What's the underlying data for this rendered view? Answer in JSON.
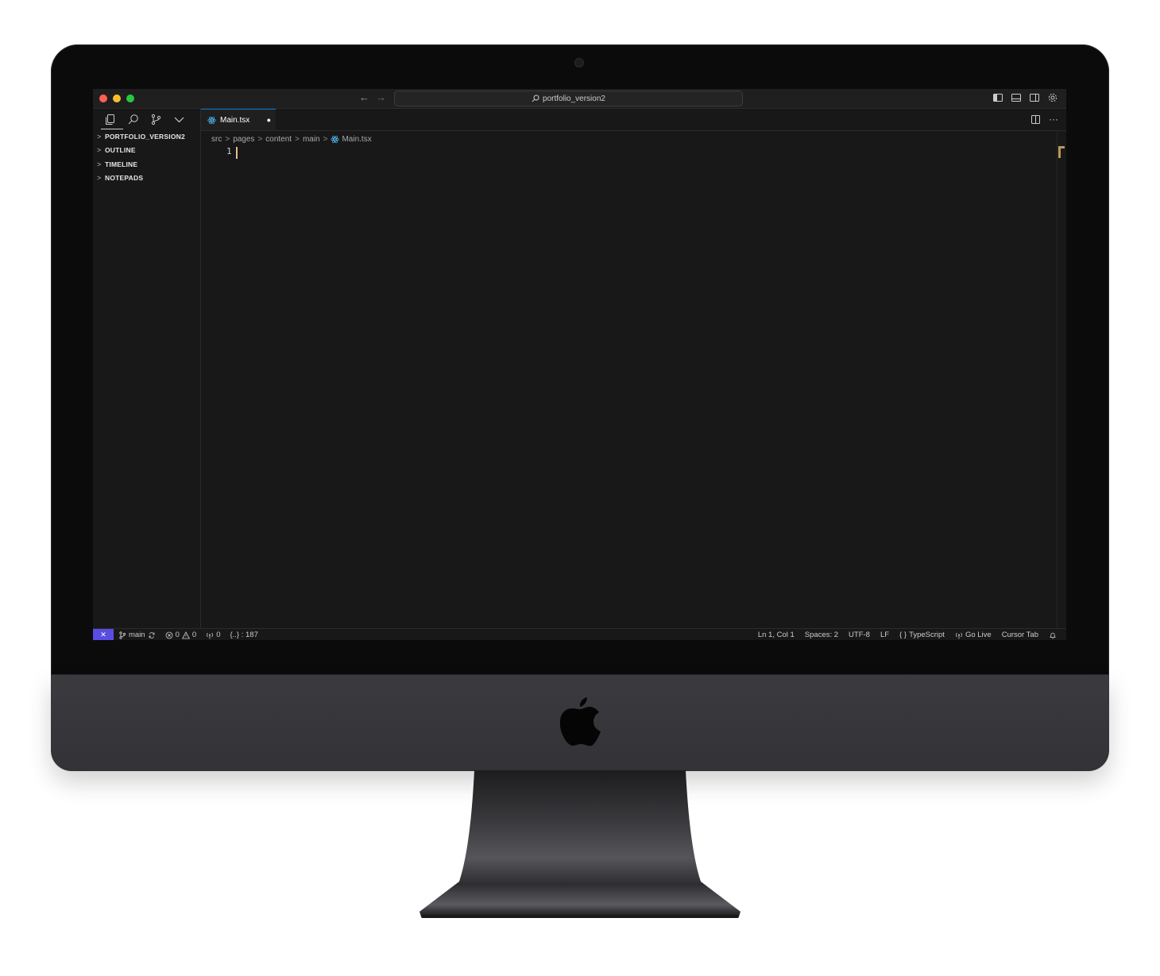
{
  "titlebar": {
    "nav_back": "←",
    "nav_forward": "→",
    "command_center": "portfolio_version2"
  },
  "sidebar": {
    "sections": [
      {
        "label": "PORTFOLIO_VERSION2"
      },
      {
        "label": "OUTLINE"
      },
      {
        "label": "TIMELINE"
      },
      {
        "label": "NOTEPADS"
      }
    ],
    "chevron": ">"
  },
  "editor": {
    "tab": {
      "label": "Main.tsx",
      "modified_dot": "●"
    },
    "more_actions": "···",
    "breadcrumb": [
      "src",
      "pages",
      "content",
      "main",
      "Main.tsx"
    ],
    "breadcrumb_sep": ">",
    "line_number": "1"
  },
  "statusbar": {
    "remote": "✕",
    "branch": "main",
    "errors": "0",
    "warnings": "0",
    "ports": "0",
    "symbol": "{..} : 187",
    "position": "Ln 1, Col 1",
    "spaces": "Spaces: 2",
    "encoding": "UTF-8",
    "eol": "LF",
    "language": "TypeScript",
    "go_live": "Go Live",
    "cursor_tab": "Cursor Tab"
  },
  "colors": {
    "accent": "#0078d4",
    "remote_badge": "#5a4de4",
    "cursor": "#e2c08d",
    "react_icon": "#4fc1ff"
  }
}
